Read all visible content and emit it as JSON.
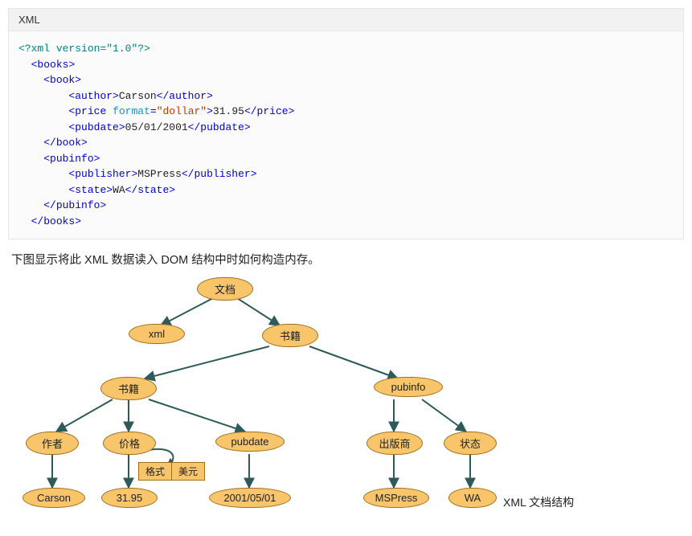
{
  "code": {
    "header": "XML",
    "decl_open": "<?",
    "decl_xml": "xml",
    "decl_ver_attr": "version",
    "decl_ver_val": "\"1.0\"",
    "decl_close": "?>",
    "tag_books": "books",
    "tag_book": "book",
    "tag_author": "author",
    "txt_author": "Carson",
    "tag_price": "price",
    "attr_format": "format",
    "val_format": "\"dollar\"",
    "txt_price": "31.95",
    "tag_pubdate": "pubdate",
    "txt_pubdate": "05/01/2001",
    "tag_pubinfo": "pubinfo",
    "tag_publisher": "publisher",
    "txt_publisher": "MSPress",
    "tag_state": "state",
    "txt_state": "WA"
  },
  "caption": "下图显示将此 XML 数据读入 DOM 结构中时如何构造内存。",
  "nodes": {
    "doc": "文档",
    "xml": "xml",
    "books": "书籍",
    "book": "书籍",
    "pubinfo": "pubinfo",
    "author": "作者",
    "price": "价格",
    "pubdate": "pubdate",
    "publisher": "出版商",
    "state": "状态",
    "carson": "Carson",
    "p3195": "31.95",
    "pdate": "2001/05/01",
    "mspress": "MSPress",
    "wa": "WA"
  },
  "attrbox": {
    "k": "格式",
    "v": "美元"
  },
  "diagram_label": "XML 文档结构"
}
